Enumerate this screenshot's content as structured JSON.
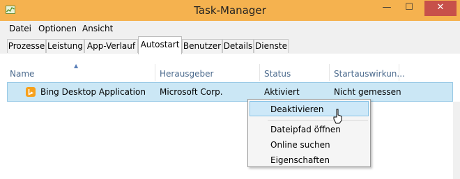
{
  "window": {
    "title": "Task-Manager",
    "minimize_glyph": "—",
    "maximize_glyph": "☐",
    "close_glyph": "✕"
  },
  "menubar": {
    "items": [
      "Datei",
      "Optionen",
      "Ansicht"
    ]
  },
  "tabs": {
    "items": [
      "Prozesse",
      "Leistung",
      "App-Verlauf",
      "Autostart",
      "Benutzer",
      "Details",
      "Dienste"
    ],
    "active": "Autostart"
  },
  "table": {
    "headers": [
      "Name",
      "Herausgeber",
      "Status",
      "Startauswirkun..."
    ],
    "sort_glyph": "▲",
    "rows": [
      {
        "name": "Bing Desktop Application",
        "publisher": "Microsoft Corp.",
        "status": "Aktiviert",
        "impact": "Nicht gemessen",
        "icon": "bing-icon"
      }
    ]
  },
  "context_menu": {
    "items": [
      "Deaktivieren",
      "Dateipfad öffnen",
      "Online suchen",
      "Eigenschaften"
    ],
    "highlighted": "Deaktivieren"
  },
  "colors": {
    "titlebar": "#f5b24f",
    "close_button": "#c7504a",
    "selected_row": "#cbe7f5",
    "menu_highlight": "#cde8f8",
    "header_text": "#4b6a8d",
    "bing_icon": "#f6a01b"
  }
}
